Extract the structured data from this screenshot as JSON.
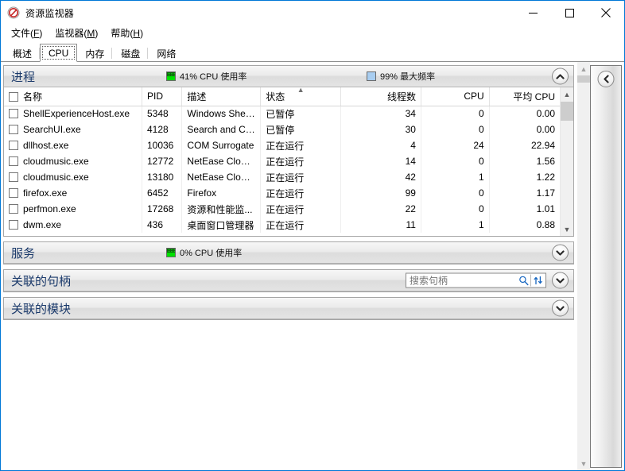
{
  "window": {
    "title": "资源监视器",
    "icon": "resource-monitor-icon",
    "accent_color": "#0078d7",
    "caption": {
      "minimize_label": "最小化",
      "maximize_label": "最大化",
      "close_label": "关闭"
    }
  },
  "menubar": {
    "items": [
      {
        "label": "文件(F)",
        "text": "文件",
        "accel": "F"
      },
      {
        "label": "监视器(M)",
        "text": "监视器",
        "accel": "M"
      },
      {
        "label": "帮助(H)",
        "text": "帮助",
        "accel": "H"
      }
    ]
  },
  "tabs": {
    "active_index": 1,
    "items": [
      {
        "label": "概述"
      },
      {
        "label": "CPU"
      },
      {
        "label": "内存"
      },
      {
        "label": "磁盘"
      },
      {
        "label": "网络"
      }
    ]
  },
  "sections": {
    "processes": {
      "title": "进程",
      "stats": [
        {
          "swatch": "green",
          "label": "41% CPU 使用率",
          "value": 41,
          "unit": "%"
        },
        {
          "swatch": "blue",
          "label": "99% 最大频率",
          "value": 99,
          "unit": "%"
        }
      ],
      "expanded": true,
      "expander_icon": "chevron-up-icon",
      "columns": [
        {
          "key": "name",
          "label": "名称",
          "align": "left"
        },
        {
          "key": "pid",
          "label": "PID",
          "align": "left"
        },
        {
          "key": "desc",
          "label": "描述",
          "align": "left"
        },
        {
          "key": "status",
          "label": "状态",
          "align": "left",
          "sorted": "asc"
        },
        {
          "key": "threads",
          "label": "线程数",
          "align": "right"
        },
        {
          "key": "cpu",
          "label": "CPU",
          "align": "right"
        },
        {
          "key": "avgcpu",
          "label": "平均 CPU",
          "align": "right"
        }
      ],
      "rows": [
        {
          "name": "ShellExperienceHost.exe",
          "pid": "5348",
          "desc": "Windows Shel...",
          "status": "已暂停",
          "threads": "34",
          "cpu": "0",
          "avgcpu": "0.00",
          "suspended": true
        },
        {
          "name": "SearchUI.exe",
          "pid": "4128",
          "desc": "Search and Co...",
          "status": "已暂停",
          "threads": "30",
          "cpu": "0",
          "avgcpu": "0.00",
          "suspended": true
        },
        {
          "name": "dllhost.exe",
          "pid": "10036",
          "desc": "COM Surrogate",
          "status": "正在运行",
          "threads": "4",
          "cpu": "24",
          "avgcpu": "22.94",
          "suspended": false
        },
        {
          "name": "cloudmusic.exe",
          "pid": "12772",
          "desc": "NetEase Cloud...",
          "status": "正在运行",
          "threads": "14",
          "cpu": "0",
          "avgcpu": "1.56",
          "suspended": false
        },
        {
          "name": "cloudmusic.exe",
          "pid": "13180",
          "desc": "NetEase Cloud...",
          "status": "正在运行",
          "threads": "42",
          "cpu": "1",
          "avgcpu": "1.22",
          "suspended": false
        },
        {
          "name": "firefox.exe",
          "pid": "6452",
          "desc": "Firefox",
          "status": "正在运行",
          "threads": "99",
          "cpu": "0",
          "avgcpu": "1.17",
          "suspended": false
        },
        {
          "name": "perfmon.exe",
          "pid": "17268",
          "desc": "资源和性能监...",
          "status": "正在运行",
          "threads": "22",
          "cpu": "0",
          "avgcpu": "1.01",
          "suspended": false
        },
        {
          "name": "dwm.exe",
          "pid": "436",
          "desc": "桌面窗口管理器",
          "status": "正在运行",
          "threads": "11",
          "cpu": "1",
          "avgcpu": "0.88",
          "suspended": false
        }
      ]
    },
    "services": {
      "title": "服务",
      "stats": [
        {
          "swatch": "green",
          "label": "0% CPU 使用率",
          "value": 0,
          "unit": "%"
        }
      ],
      "expanded": false,
      "expander_icon": "chevron-down-icon"
    },
    "handles": {
      "title": "关联的句柄",
      "expanded": false,
      "expander_icon": "chevron-down-icon",
      "search": {
        "placeholder": "搜索句柄",
        "value": "",
        "search_icon": "magnifier-icon",
        "refresh_icon": "refresh-arrows-icon"
      }
    },
    "modules": {
      "title": "关联的模块",
      "expanded": false,
      "expander_icon": "chevron-down-icon"
    }
  },
  "side_panel": {
    "toggle_icon": "chevron-left-icon",
    "toggle_label": "展开图表面板"
  }
}
